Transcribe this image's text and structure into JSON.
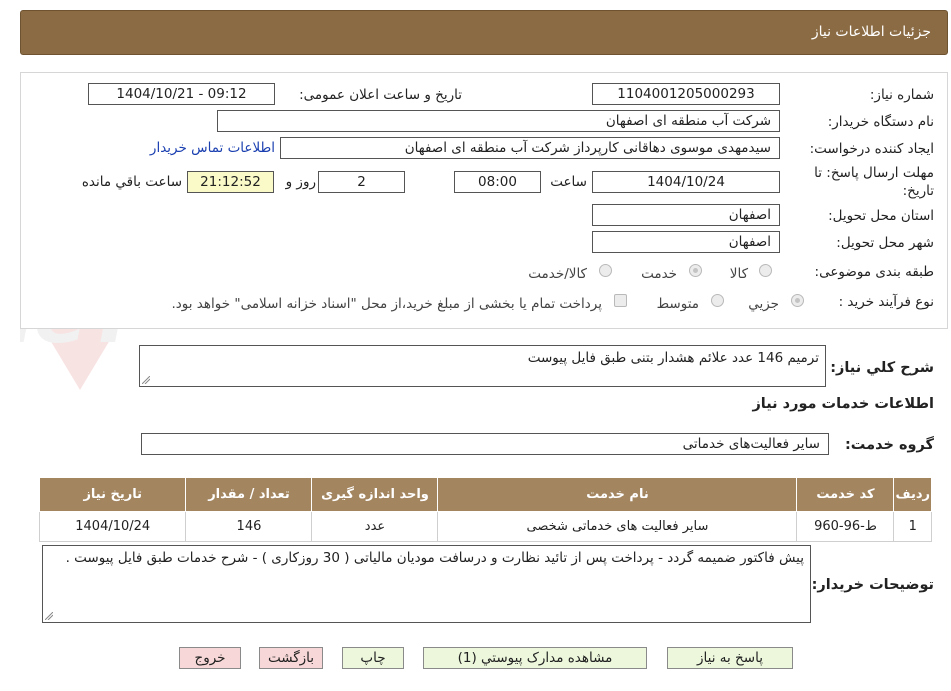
{
  "header": {
    "title": "جزئیات اطلاعات نیاز"
  },
  "form": {
    "need_number_label": "شماره نیاز:",
    "need_number": "1104001205000293",
    "announce_label": "تاریخ و ساعت اعلان عمومی:",
    "announce_value": "1404/10/21 - 09:12",
    "buyer_org_label": "نام دستگاه خریدار:",
    "buyer_org": "شرکت آب منطقه ای اصفهان",
    "creator_label": "ایجاد کننده درخواست:",
    "creator": "سیدمهدی موسوی دهاقانی کارپرداز شرکت آب منطقه ای اصفهان",
    "contact_link": "اطلاعات تماس خریدار",
    "deadline_label_1": "مهلت ارسال پاسخ: تا",
    "deadline_label_2": "تاریخ:",
    "deadline_date": "1404/10/24",
    "time_label": "ساعت",
    "deadline_time": "08:00",
    "days_value": "2",
    "days_label": "روز و",
    "remaining_time": "21:12:52",
    "remaining_label": "ساعت باقي مانده",
    "province_label": "استان محل تحویل:",
    "province": "اصفهان",
    "city_label": "شهر محل تحویل:",
    "city": "اصفهان",
    "category_label": "طبقه بندی موضوعی:",
    "category_options": [
      "کالا",
      "خدمت",
      "کالا/خدمت"
    ],
    "category_selected": "خدمت",
    "process_label": "نوع فرآیند خرید :",
    "process_options": [
      "جزیي",
      "متوسط"
    ],
    "process_selected": "جزیي",
    "treasury_note": "پرداخت تمام یا بخشی از مبلغ خرید،از محل \"اسناد خزانه اسلامی\" خواهد بود."
  },
  "summary": {
    "label": "شرح کلي نياز:",
    "value": "ترمیم 146 عدد علائم هشدار بتنی طبق فایل پیوست"
  },
  "services": {
    "section_title": "اطلاعات خدمات مورد نياز",
    "group_label": "گروه خدمت:",
    "group_value": "سایر فعالیت‌های خدماتی",
    "columns": [
      "رديف",
      "کد خدمت",
      "نام خدمت",
      "واحد اندازه گیری",
      "تعداد / مقدار",
      "تاريخ نياز"
    ],
    "rows": [
      [
        "1",
        "ط-96-960",
        "سایر فعالیت های خدماتی شخصی",
        "عدد",
        "146",
        "1404/10/24"
      ]
    ]
  },
  "buyer_notes": {
    "label": "توضيحات خريدار:",
    "value": "پیش فاکتور ضمیمه گردد - پرداخت پس از تائید نظارت و درسافت مودیان مالیاتی ( 30 روزکاری ) - شرح خدمات طبق فایل پیوست ."
  },
  "buttons": {
    "reply": "پاسخ به نياز",
    "attachments": "مشاهده مدارک پيوستي (1)",
    "print": "چاپ",
    "back": "بازگشت",
    "exit": "خروج"
  },
  "watermark": {
    "text": "AriaTender.neT"
  },
  "colors": {
    "header_bg": "#8b6b43",
    "table_header_bg": "#a38560",
    "remaining_bg": "#fafac8",
    "button_bg": "#ecf7dc",
    "exit_bg": "#f7d7d7",
    "link": "#1a3fb0"
  }
}
